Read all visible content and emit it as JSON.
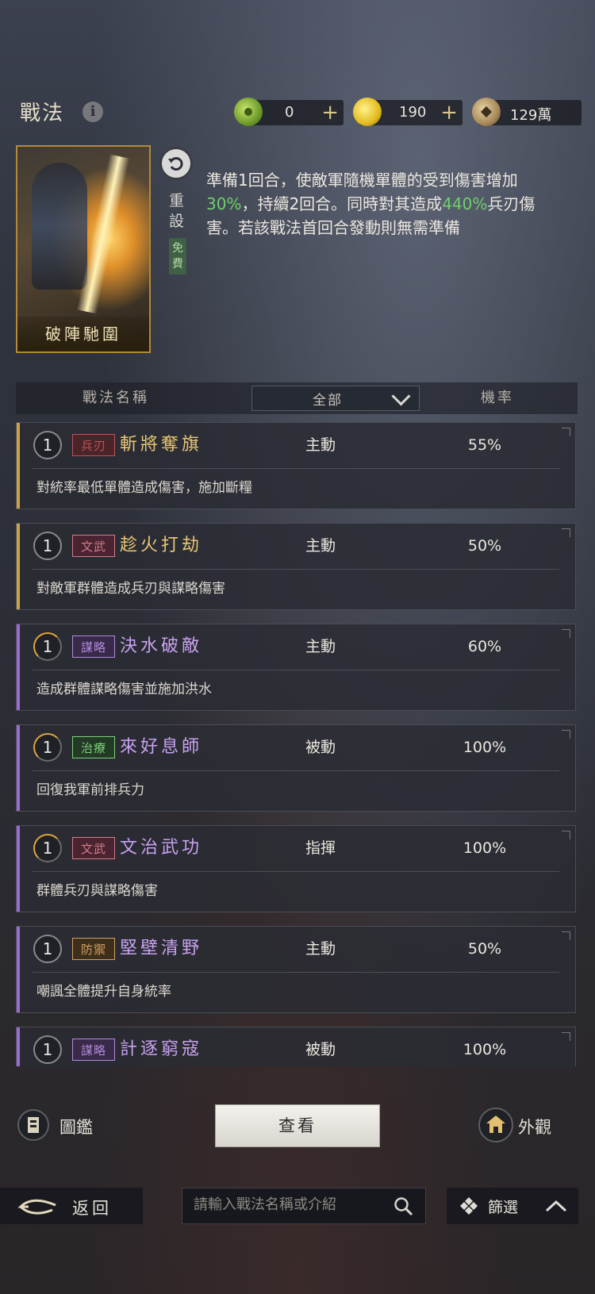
{
  "header": {
    "title": "戰法",
    "info_icon": "i",
    "resources": [
      {
        "icon": "jade-coin-icon",
        "value": "0",
        "plus": "+"
      },
      {
        "icon": "gold-coin-icon",
        "value": "190",
        "plus": "+"
      },
      {
        "icon": "copper-coin-icon",
        "value": "129萬"
      }
    ]
  },
  "tactic_card": {
    "name": "破陣馳圍",
    "reset_label": "重設",
    "free_label": "免費",
    "desc_parts": [
      {
        "text": "準備1回合，使敵軍隨機單體的受到傷害增加",
        "green": false
      },
      {
        "text": "30%",
        "green": true
      },
      {
        "text": "，持續2回合。同時對其造成",
        "green": false
      },
      {
        "text": "440%",
        "green": true
      },
      {
        "text": "兵刃傷害。若該戰法首回合發動則無需準備",
        "green": false
      }
    ]
  },
  "table_header": {
    "name_col": "戰法名稱",
    "filter_value": "全部",
    "rate_col": "機率"
  },
  "tactics": [
    {
      "level": "1",
      "type": "兵刃",
      "name": "斬將奪旗",
      "mode": "主動",
      "rate": "55%",
      "desc": "對統率最低單體造成傷害，施加斷糧",
      "stripe": "#c9a24a",
      "name_color": "#e9c675",
      "type_color": "#b8555a",
      "type_bg": "#4a2428",
      "ring": false
    },
    {
      "level": "1",
      "type": "文武",
      "name": "趁火打劫",
      "mode": "主動",
      "rate": "50%",
      "desc": "對敵軍群體造成兵刃與謀略傷害",
      "stripe": "#c9a24a",
      "name_color": "#e9c675",
      "type_color": "#d07a8a",
      "type_bg": "#4a2430",
      "ring": false
    },
    {
      "level": "1",
      "type": "謀略",
      "name": "決水破敵",
      "mode": "主動",
      "rate": "60%",
      "desc": "造成群體謀略傷害並施加洪水",
      "stripe": "#9b6ad2",
      "name_color": "#c8a2f0",
      "type_color": "#b08ad8",
      "type_bg": "#3a2a4a",
      "ring": true
    },
    {
      "level": "1",
      "type": "治療",
      "name": "來好息師",
      "mode": "被動",
      "rate": "100%",
      "desc": "回復我軍前排兵力",
      "stripe": "#9b6ad2",
      "name_color": "#c8a2f0",
      "type_color": "#7ed07a",
      "type_bg": "#233a26",
      "ring": true
    },
    {
      "level": "1",
      "type": "文武",
      "name": "文治武功",
      "mode": "指揮",
      "rate": "100%",
      "desc": "群體兵刃與謀略傷害",
      "stripe": "#9b6ad2",
      "name_color": "#c8a2f0",
      "type_color": "#d07a8a",
      "type_bg": "#4a2430",
      "ring": true
    },
    {
      "level": "1",
      "type": "防禦",
      "name": "堅壁清野",
      "mode": "主動",
      "rate": "50%",
      "desc": "嘲諷全體提升自身統率",
      "stripe": "#9b6ad2",
      "name_color": "#c8a2f0",
      "type_color": "#d0a060",
      "type_bg": "#3e2f1c",
      "ring": false
    },
    {
      "level": "1",
      "type": "謀略",
      "name": "計逐窮寇",
      "mode": "被動",
      "rate": "100%",
      "desc": "",
      "stripe": "#9b6ad2",
      "name_color": "#c8a2f0",
      "type_color": "#b08ad8",
      "type_bg": "#3a2a4a",
      "ring": false
    }
  ],
  "bottom": {
    "catalog_label": "圖鑑",
    "view_label": "查看",
    "appearance_label": "外觀",
    "back_label": "返回",
    "search_placeholder": "請輸入戰法名稱或介紹",
    "filter_label": "篩選"
  }
}
